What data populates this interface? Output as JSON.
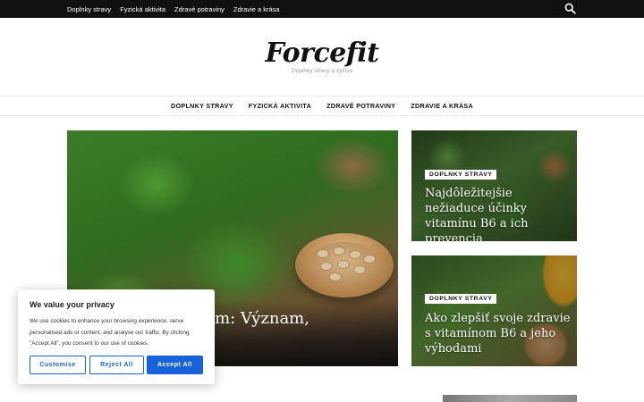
{
  "topbar": {
    "links": [
      "Doplnky stravy",
      "Fyzická aktivita",
      "Zdravé potraviny",
      "Zdravie a krása"
    ],
    "search_icon": "search-icon"
  },
  "header": {
    "logo": "Forcefit",
    "tagline": "Doplnky stravy a výživa"
  },
  "nav": {
    "items": [
      "DOPLNKY STRAVY",
      "FYZICKÁ AKTIVITA",
      "ZDRAVÉ POTRAVINY",
      "ZDRAVIE A KRÁSA"
    ]
  },
  "hero": {
    "title": "ca biotínom: Význam,"
  },
  "cards": [
    {
      "badge": "DOPLNKY STRAVY",
      "title": "Najdôležitejšie nežiaduce účinky vitamínu B6 a ich prevencia"
    },
    {
      "badge": "DOPLNKY STRAVY",
      "title": "Ako zlepšiť svoje zdravie s vitamínom B6 a jeho výhodami"
    }
  ],
  "cookie": {
    "title": "We value your privacy",
    "text": "We use cookies to enhance your browsing experience, serve personalised ads or content, and analyse our traffic. By clicking \"Accept All\", you consent to our use of cookies.",
    "customise": "Customise",
    "reject": "Reject All",
    "accept": "Accept All"
  },
  "colors": {
    "topbar_bg": "#111111",
    "accent": "#1863dc",
    "badge_bg": "#ffffff"
  }
}
